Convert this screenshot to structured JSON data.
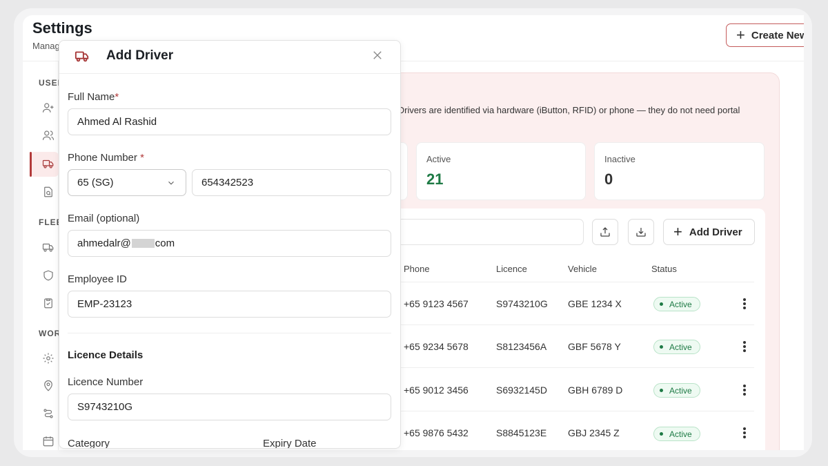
{
  "page": {
    "title": "Settings",
    "subtitle": "Manag",
    "create_button": "Create New"
  },
  "sidebar": {
    "sections": [
      {
        "label": "USER"
      },
      {
        "label": "FLEE"
      },
      {
        "label": "WOR"
      }
    ]
  },
  "drivers": {
    "info_text": "s. Drivers are identified via hardware (iButton, RFID) or phone — they do not need portal",
    "stats": [
      {
        "label": "Active",
        "value": "21",
        "color": "#1e7a45"
      },
      {
        "label": "Inactive",
        "value": "0",
        "color": "#333333"
      }
    ],
    "add_button": "Add Driver",
    "columns": [
      "Phone",
      "Licence",
      "Vehicle",
      "Status"
    ],
    "rows": [
      {
        "phone": "+65 9123 4567",
        "licence": "S9743210G",
        "vehicle": "GBE 1234 X",
        "status": "Active"
      },
      {
        "phone": "+65 9234 5678",
        "licence": "S8123456A",
        "vehicle": "GBF 5678 Y",
        "status": "Active"
      },
      {
        "phone": "+65 9012 3456",
        "licence": "S6932145D",
        "vehicle": "GBH 6789 D",
        "status": "Active"
      },
      {
        "phone": "+65 9876 5432",
        "licence": "S8845123E",
        "vehicle": "GBJ 2345 Z",
        "status": "Active"
      }
    ]
  },
  "modal": {
    "title": "Add Driver",
    "fields": {
      "full_name": {
        "label": "Full Name",
        "required_mark": "*",
        "value": "Ahmed Al Rashid"
      },
      "phone": {
        "label": "Phone Number",
        "required_mark": "*",
        "country_code": "65 (SG)",
        "value": "654342523"
      },
      "email": {
        "label": "Email (optional)",
        "value_prefix": "ahmedalr@",
        "value_suffix": "com"
      },
      "employee_id": {
        "label": "Employee ID",
        "value": "EMP-23123"
      },
      "licence_section": "Licence Details",
      "licence_number": {
        "label": "Licence Number",
        "value": "S9743210G"
      },
      "category": {
        "label": "Category"
      },
      "expiry": {
        "label": "Expiry Date"
      }
    }
  },
  "colors": {
    "accent": "#b23a3a",
    "active_green": "#1e7a45"
  }
}
